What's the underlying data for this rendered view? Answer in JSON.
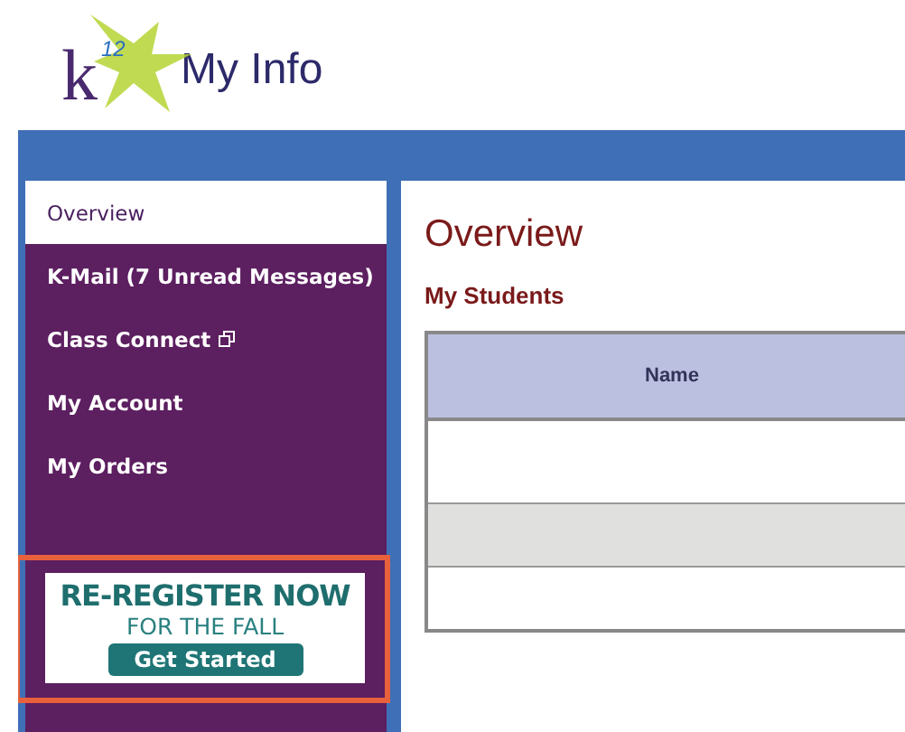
{
  "header": {
    "logo": {
      "letter": "k",
      "superscript": "12"
    },
    "title": "My Info"
  },
  "sidebar": {
    "items": [
      {
        "label": "Overview",
        "selected": true,
        "external": false
      },
      {
        "label": "K-Mail (7 Unread Messages)",
        "selected": false,
        "external": false
      },
      {
        "label": "Class Connect",
        "selected": false,
        "external": true
      },
      {
        "label": "My Account",
        "selected": false,
        "external": false
      },
      {
        "label": "My Orders",
        "selected": false,
        "external": false
      }
    ],
    "promo": {
      "headline": "RE-REGISTER NOW",
      "subline": "FOR THE FALL",
      "button": "Get Started",
      "highlighted": true
    }
  },
  "content": {
    "title": "Overview",
    "section": "My Students",
    "table": {
      "columns": [
        "Name"
      ],
      "rows": [
        {
          "shaded": false
        },
        {
          "shaded": true
        },
        {
          "shaded": false
        }
      ]
    }
  }
}
